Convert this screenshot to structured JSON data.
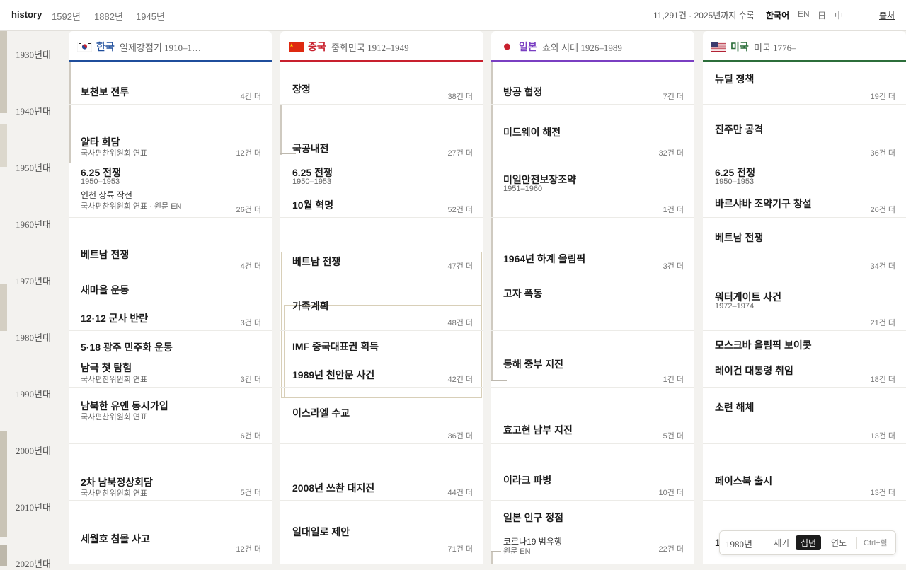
{
  "topbar": {
    "brand": "history",
    "year_links": [
      "1592년",
      "1882년",
      "1945년"
    ],
    "stat": "11,291건 · 2025년까지 수록",
    "languages": [
      "한국어",
      "EN",
      "日",
      "中"
    ],
    "active_language": "한국어",
    "sources": "출처"
  },
  "axis": {
    "decades": [
      "1930년대",
      "1940년대",
      "1950년대",
      "1960년대",
      "1970년대",
      "1980년대",
      "1990년대",
      "2000년대",
      "2010년대",
      "2020년대"
    ]
  },
  "columns": [
    {
      "country": "한국",
      "era": "일제강점기 1910–1…",
      "color": "#1f4e9c",
      "flag": "korea-flag-icon",
      "cells": [
        {
          "events": [
            {
              "title": "보천보 전투"
            }
          ],
          "more": "4건 더"
        },
        {
          "events": [
            {
              "title": "얄타 회담",
              "source": "국사편찬위원회 연표"
            }
          ],
          "more": "12건 더"
        },
        {
          "events": [
            {
              "title": "6.25 전쟁",
              "years": "1950–1953"
            },
            {
              "title": "인천 상륙 작전",
              "source": "국사편찬위원회 연표 · 원문 EN"
            }
          ],
          "more": "26건 더"
        },
        {
          "events": [
            {
              "title": "베트남 전쟁"
            }
          ],
          "more": "4건 더"
        },
        {
          "events": [
            {
              "title": "새마을 운동"
            },
            {
              "title": "12·12 군사 반란"
            }
          ],
          "more": "3건 더"
        },
        {
          "events": [
            {
              "title": "5·18 광주 민주화 운동"
            },
            {
              "title": "남극 첫 탐험",
              "source": "국사편찬위원회 연표"
            }
          ],
          "more": "3건 더"
        },
        {
          "events": [
            {
              "title": "남북한 유엔 동시가입",
              "source": "국사편찬위원회 연표"
            }
          ],
          "more": "6건 더"
        },
        {
          "events": [
            {
              "title": "2차 남북정상회담",
              "source": "국사편찬위원회 연표"
            }
          ],
          "more": "5건 더"
        },
        {
          "events": [
            {
              "title": "세월호 침몰 사고"
            }
          ],
          "more": "12건 더"
        }
      ]
    },
    {
      "country": "중국",
      "era": "중화민국 1912–1949",
      "color": "#c8202e",
      "flag": "china-flag-icon",
      "cells": [
        {
          "events": [
            {
              "title": "장정"
            }
          ],
          "more": "38건 더"
        },
        {
          "events": [
            {
              "title": "국공내전"
            }
          ],
          "more": "27건 더"
        },
        {
          "events": [
            {
              "title": "6.25 전쟁",
              "years": "1950–1953"
            },
            {
              "title": "10월 혁명"
            }
          ],
          "more": "52건 더"
        },
        {
          "events": [
            {
              "title": "베트남 전쟁"
            }
          ],
          "more": "47건 더"
        },
        {
          "events": [
            {
              "title": "가족계획"
            }
          ],
          "more": "48건 더"
        },
        {
          "events": [
            {
              "title": "IMF 중국대표권 획득"
            },
            {
              "title": "1989년 천안문 사건"
            }
          ],
          "more": "42건 더"
        },
        {
          "events": [
            {
              "title": "이스라엘 수교"
            }
          ],
          "more": "36건 더"
        },
        {
          "events": [
            {
              "title": "2008년 쓰촨 대지진"
            }
          ],
          "more": "44건 더"
        },
        {
          "events": [
            {
              "title": "일대일로 제안"
            }
          ],
          "more": "71건 더"
        }
      ]
    },
    {
      "country": "일본",
      "era": "쇼와 시대 1926–1989",
      "color": "#7a3fc2",
      "flag": "japan-flag-icon",
      "cells": [
        {
          "events": [
            {
              "title": "방공 협정"
            }
          ],
          "more": "7건 더"
        },
        {
          "events": [
            {
              "title": "미드웨이 해전"
            }
          ],
          "more": "32건 더"
        },
        {
          "events": [
            {
              "title": "미일안전보장조약",
              "years": "1951–1960"
            }
          ],
          "more": "1건 더"
        },
        {
          "events": [
            {
              "title": "1964년 하계 올림픽"
            }
          ],
          "more": "3건 더"
        },
        {
          "events": [
            {
              "title": "고자 폭동"
            }
          ],
          "more": ""
        },
        {
          "events": [
            {
              "title": "동해 중부 지진"
            }
          ],
          "more": "1건 더"
        },
        {
          "events": [
            {
              "title": "효고현 남부 지진"
            }
          ],
          "more": "5건 더"
        },
        {
          "events": [
            {
              "title": "이라크 파병"
            }
          ],
          "more": "10건 더"
        },
        {
          "events": [
            {
              "title": "일본 인구 정점"
            },
            {
              "title": "코로나19 범유행",
              "source": "원문 EN"
            }
          ],
          "more": "22건 더"
        }
      ]
    },
    {
      "country": "미국",
      "era": "미국 1776–",
      "color": "#2c6e3a",
      "flag": "usa-flag-icon",
      "cells": [
        {
          "events": [
            {
              "title": "뉴딜 정책"
            }
          ],
          "more": "19건 더"
        },
        {
          "events": [
            {
              "title": "진주만 공격"
            }
          ],
          "more": "36건 더"
        },
        {
          "events": [
            {
              "title": "6.25 전쟁",
              "years": "1950–1953"
            },
            {
              "title": "바르샤바 조약기구 창설"
            }
          ],
          "more": "26건 더"
        },
        {
          "events": [
            {
              "title": "베트남 전쟁"
            }
          ],
          "more": "34건 더"
        },
        {
          "events": [
            {
              "title": "워터게이트 사건",
              "years": "1972–1974"
            }
          ],
          "more": "21건 더"
        },
        {
          "events": [
            {
              "title": "모스크바 올림픽 보이콧"
            },
            {
              "title": "레이건 대통령 취임"
            }
          ],
          "more": "18건 더"
        },
        {
          "events": [
            {
              "title": "소련 해체"
            }
          ],
          "more": "13건 더"
        },
        {
          "events": [
            {
              "title": "페이스북 출시"
            }
          ],
          "more": "13건 더"
        },
        {
          "events": [
            {
              "title": "1"
            }
          ],
          "more": ""
        }
      ]
    }
  ],
  "zoom": {
    "year": "1980년",
    "options": [
      "세기",
      "십년",
      "연도"
    ],
    "active": "십년",
    "shortcut": "Ctrl+휠"
  }
}
